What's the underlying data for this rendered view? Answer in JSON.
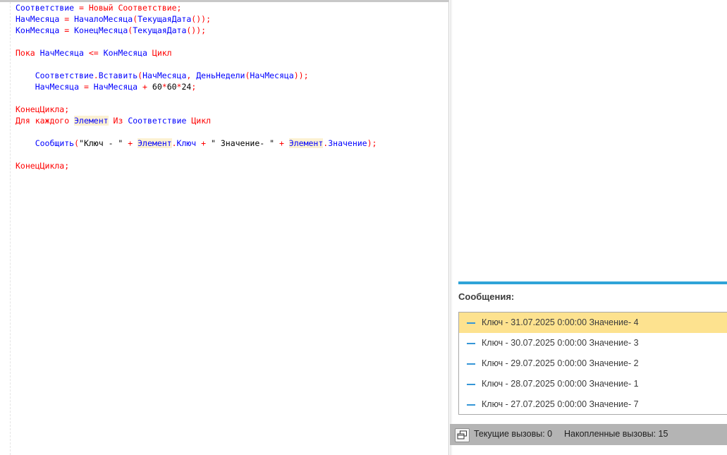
{
  "code": {
    "lines": [
      [
        {
          "t": "Соответствие",
          "c": "id"
        },
        {
          "t": " = ",
          "c": "kw"
        },
        {
          "t": "Новый",
          "c": "kw"
        },
        {
          "t": " ",
          "c": "plain"
        },
        {
          "t": "Соответствие",
          "c": "kw"
        },
        {
          "t": ";",
          "c": "kw"
        }
      ],
      [
        {
          "t": "НачМесяца",
          "c": "id"
        },
        {
          "t": " = ",
          "c": "kw"
        },
        {
          "t": "НачалоМесяца",
          "c": "id"
        },
        {
          "t": "(",
          "c": "kw"
        },
        {
          "t": "ТекущаяДата",
          "c": "id"
        },
        {
          "t": "());",
          "c": "kw"
        }
      ],
      [
        {
          "t": "КонМесяца",
          "c": "id"
        },
        {
          "t": " = ",
          "c": "kw"
        },
        {
          "t": "КонецМесяца",
          "c": "id"
        },
        {
          "t": "(",
          "c": "kw"
        },
        {
          "t": "ТекущаяДата",
          "c": "id"
        },
        {
          "t": "());",
          "c": "kw"
        }
      ],
      [],
      [
        {
          "t": "Пока",
          "c": "kw"
        },
        {
          "t": " ",
          "c": "plain"
        },
        {
          "t": "НачМесяца",
          "c": "id"
        },
        {
          "t": " <= ",
          "c": "kw"
        },
        {
          "t": "КонМесяца",
          "c": "id"
        },
        {
          "t": " ",
          "c": "plain"
        },
        {
          "t": "Цикл",
          "c": "kw"
        }
      ],
      [],
      [
        {
          "t": "    ",
          "c": "plain"
        },
        {
          "t": "Соответствие",
          "c": "id"
        },
        {
          "t": ".",
          "c": "kw"
        },
        {
          "t": "Вставить",
          "c": "id"
        },
        {
          "t": "(",
          "c": "kw"
        },
        {
          "t": "НачМесяца",
          "c": "id"
        },
        {
          "t": ", ",
          "c": "kw"
        },
        {
          "t": "ДеньНедели",
          "c": "id"
        },
        {
          "t": "(",
          "c": "kw"
        },
        {
          "t": "НачМесяца",
          "c": "id"
        },
        {
          "t": "));",
          "c": "kw"
        }
      ],
      [
        {
          "t": "    ",
          "c": "plain"
        },
        {
          "t": "НачМесяца",
          "c": "id"
        },
        {
          "t": " = ",
          "c": "kw"
        },
        {
          "t": "НачМесяца",
          "c": "id"
        },
        {
          "t": " + ",
          "c": "kw"
        },
        {
          "t": "60",
          "c": "num"
        },
        {
          "t": "*",
          "c": "kw"
        },
        {
          "t": "60",
          "c": "num"
        },
        {
          "t": "*",
          "c": "kw"
        },
        {
          "t": "24",
          "c": "num"
        },
        {
          "t": ";",
          "c": "kw"
        }
      ],
      [],
      [
        {
          "t": "КонецЦикла;",
          "c": "kw"
        }
      ],
      [
        {
          "t": "Для каждого",
          "c": "kw"
        },
        {
          "t": " ",
          "c": "plain"
        },
        {
          "t": "Элемент",
          "c": "id",
          "hl": true
        },
        {
          "t": " ",
          "c": "plain"
        },
        {
          "t": "Из",
          "c": "kw"
        },
        {
          "t": " ",
          "c": "plain"
        },
        {
          "t": "Соответствие",
          "c": "id"
        },
        {
          "t": " ",
          "c": "plain"
        },
        {
          "t": "Цикл",
          "c": "kw"
        }
      ],
      [],
      [
        {
          "t": "    ",
          "c": "plain"
        },
        {
          "t": "Сообщить",
          "c": "id"
        },
        {
          "t": "(",
          "c": "kw"
        },
        {
          "t": "\"Ключ - \"",
          "c": "str"
        },
        {
          "t": " + ",
          "c": "kw"
        },
        {
          "t": "Элемент",
          "c": "id",
          "hl": true
        },
        {
          "t": ".",
          "c": "kw"
        },
        {
          "t": "Ключ",
          "c": "id"
        },
        {
          "t": " + ",
          "c": "kw"
        },
        {
          "t": "\" Значение- \"",
          "c": "str"
        },
        {
          "t": " + ",
          "c": "kw"
        },
        {
          "t": "Элемент",
          "c": "id",
          "hl": true
        },
        {
          "t": ".",
          "c": "kw"
        },
        {
          "t": "Значение",
          "c": "id"
        },
        {
          "t": ");",
          "c": "kw"
        }
      ],
      [],
      [
        {
          "t": "КонецЦикла;",
          "c": "kw"
        }
      ]
    ]
  },
  "messages": {
    "title": "Сообщения:",
    "items": [
      {
        "text": "Ключ - 31.07.2025 0:00:00 Значение- 4",
        "active": true
      },
      {
        "text": "Ключ - 30.07.2025 0:00:00 Значение- 3",
        "active": false
      },
      {
        "text": "Ключ - 29.07.2025 0:00:00 Значение- 2",
        "active": false
      },
      {
        "text": "Ключ - 28.07.2025 0:00:00 Значение- 1",
        "active": false
      },
      {
        "text": "Ключ - 27.07.2025 0:00:00 Значение- 7",
        "active": false
      }
    ]
  },
  "status": {
    "current_calls": "Текущие вызовы: 0",
    "accumulated_calls": "Накопленные вызовы: 15",
    "icon": "windows-icon"
  },
  "colors": {
    "keyword": "#ff0000",
    "identifier": "#0000ff",
    "highlight": "#fcf1d2",
    "accent": "#2fa4d8",
    "selected_row": "#fde28f"
  }
}
